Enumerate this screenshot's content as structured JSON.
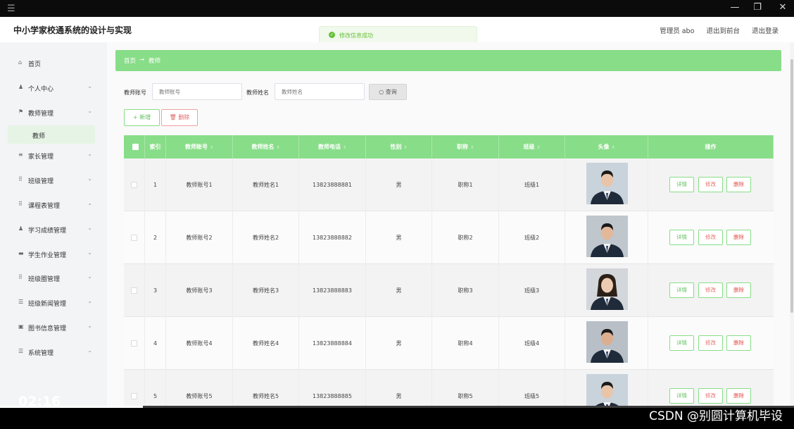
{
  "app": {
    "title": "中小学家校通系统的设计与实现",
    "header_links": {
      "admin": "管理员 abo",
      "exit_front": "退出到前台",
      "logout": "退出登录"
    },
    "toast": "修改信息成功"
  },
  "sidebar": {
    "items": [
      {
        "label": "首页",
        "icon": "home-icon",
        "glyph": "⌂",
        "chevron": false
      },
      {
        "label": "个人中心",
        "icon": "user-icon",
        "glyph": "♟",
        "chevron": true
      },
      {
        "label": "教师管理",
        "icon": "flag-icon",
        "glyph": "⚑",
        "chevron": true
      },
      {
        "label": "教师",
        "icon": "",
        "glyph": "",
        "chevron": false,
        "sub": true
      },
      {
        "label": "家长管理",
        "icon": "list-icon",
        "glyph": "≡",
        "chevron": true
      },
      {
        "label": "班级管理",
        "icon": "grid-icon",
        "glyph": "⠿",
        "chevron": true
      },
      {
        "label": "课程表管理",
        "icon": "grid-icon",
        "glyph": "⠿",
        "chevron": true
      },
      {
        "label": "学习成绩管理",
        "icon": "user-icon",
        "glyph": "♟",
        "chevron": true
      },
      {
        "label": "学生作业管理",
        "icon": "folder-icon",
        "glyph": "▬",
        "chevron": true
      },
      {
        "label": "班级圈管理",
        "icon": "grid-icon",
        "glyph": "⠿",
        "chevron": true
      },
      {
        "label": "班级新闻管理",
        "icon": "sliders-icon",
        "glyph": "☰",
        "chevron": true
      },
      {
        "label": "图书信息管理",
        "icon": "lock-icon",
        "glyph": "▣",
        "chevron": true
      },
      {
        "label": "系统管理",
        "icon": "stack-icon",
        "glyph": "☰",
        "chevron": true
      }
    ]
  },
  "breadcrumb": {
    "home": "首页",
    "arrow": "→",
    "current": "教师"
  },
  "search": {
    "account_label": "教师账号",
    "account_placeholder": "教师账号",
    "name_label": "教师姓名",
    "name_placeholder": "教师姓名",
    "query_button": "查询",
    "query_icon": "○"
  },
  "actions": {
    "add": "+ 新增",
    "delete": "🗑 删除"
  },
  "table": {
    "columns": [
      "",
      "索引",
      "教师账号",
      "教师姓名",
      "教师电话",
      "性别",
      "职称",
      "班级",
      "头像",
      "操作"
    ],
    "rows": [
      {
        "index": "1",
        "account": "教师账号1",
        "name": "教师姓名1",
        "phone": "13823888881",
        "gender": "男",
        "title": "职称1",
        "class": "班级1"
      },
      {
        "index": "2",
        "account": "教师账号2",
        "name": "教师姓名2",
        "phone": "13823888882",
        "gender": "男",
        "title": "职称2",
        "class": "班级2"
      },
      {
        "index": "3",
        "account": "教师账号3",
        "name": "教师姓名3",
        "phone": "13823888883",
        "gender": "男",
        "title": "职称3",
        "class": "班级3"
      },
      {
        "index": "4",
        "account": "教师账号4",
        "name": "教师姓名4",
        "phone": "13823888884",
        "gender": "男",
        "title": "职称4",
        "class": "班级4"
      },
      {
        "index": "5",
        "account": "教师账号5",
        "name": "教师姓名5",
        "phone": "13823888885",
        "gender": "男",
        "title": "职称5",
        "class": "班级5"
      }
    ],
    "row_buttons": {
      "detail": "详情",
      "edit": "修改",
      "remove": "删除"
    }
  },
  "player": {
    "time": "02:16",
    "progress": 0.18,
    "watermark": "CSDN @别圆计算机毕设"
  },
  "colors": {
    "accent": "#88dd88",
    "danger": "#e0504a",
    "toast": "#67c23a"
  }
}
